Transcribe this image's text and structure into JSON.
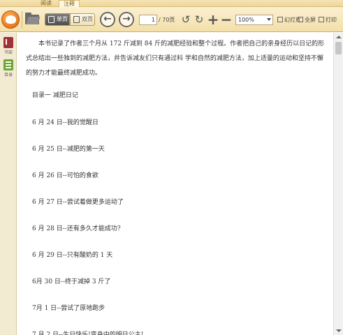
{
  "tabs": {
    "read": "阅读",
    "notes": "注释"
  },
  "toolbar": {
    "single_page": "单页",
    "double_page": "双页",
    "current_page": "1",
    "total_pages": "/ 70页",
    "zoom": "100%",
    "slideshow": "幻灯片",
    "fullscreen": "全屏",
    "print": "打印"
  },
  "sidebar": {
    "bookshelf": "书架",
    "toc": "目录"
  },
  "document": {
    "intro": "本书记录了作者三个月从 172 斤减到 84 斤的减肥经验和整个过程。作者把自己的亲身经历以日记的形式总结出一些独到的减肥方法，并告诉减友们只有通过科 学和自然的减肥方法，加上适量的运动和坚持不懈的努力才能最终减肥成功。",
    "toc_entries": [
      "目录一 减肥日记",
      "6 月 24 日--我的觉醒日",
      "6 月 25 日--减肥的第一天",
      "6 月 26 日--可怕的食欲",
      "6 月 27 日--尝试着做更多运动了",
      "6 月 28 日--还有多久才能成功?",
      "6 月 29 日--只有酸奶的 1 天",
      "6月 30 日--终于减掉 3 斤了",
      "7月 1 日--尝试了原地跑步",
      "7 月 2 日--生日快乐!变身中的明日公主!"
    ]
  },
  "icons": {
    "logo": "app-logo-icon",
    "open": "folder-icon",
    "prev": "arrow-left-icon",
    "next": "arrow-right-icon",
    "rotate_left": "rotate-left-icon",
    "rotate_right": "rotate-right-icon",
    "zoom_in": "plus-icon",
    "zoom_out": "minus-icon"
  },
  "colors": {
    "toolbar_bg": "#f3dfa8",
    "accent": "#e8771f",
    "sidebar_bg": "#f3ead2"
  }
}
